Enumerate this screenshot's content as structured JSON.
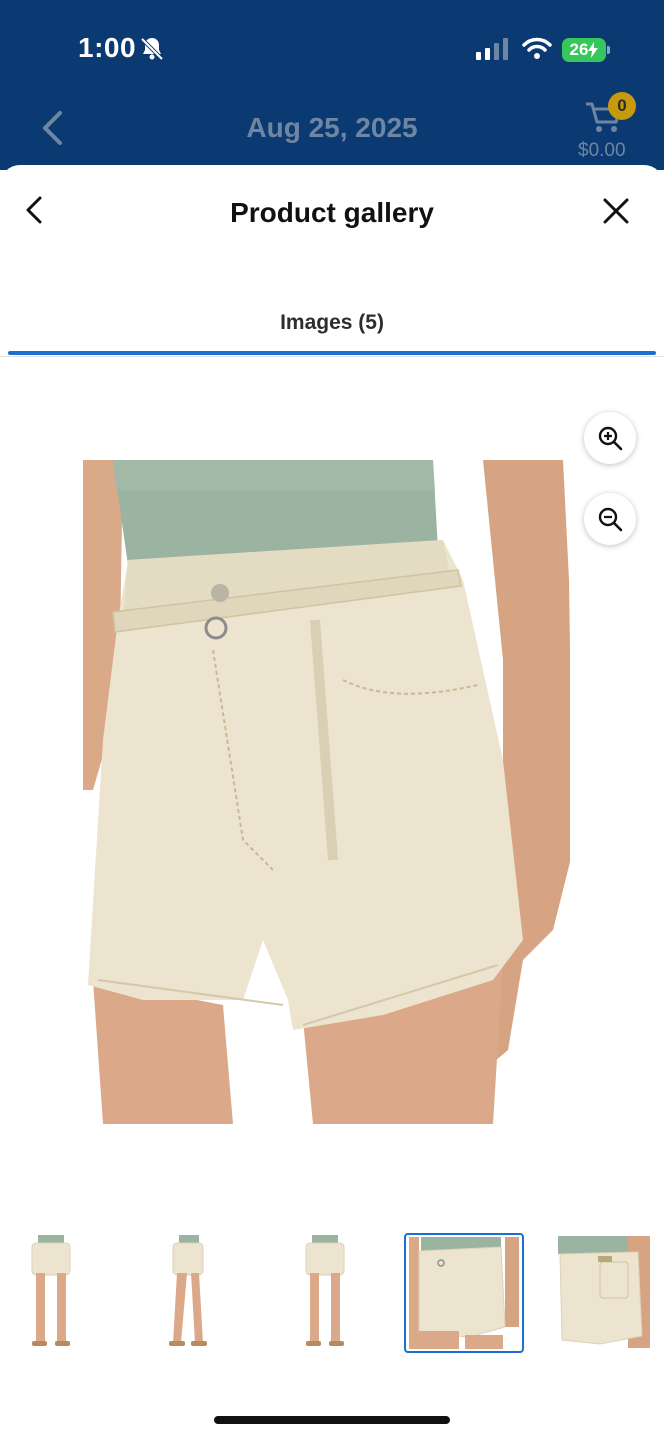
{
  "status_bar": {
    "time": "1:00",
    "battery": "26"
  },
  "header": {
    "date": "Aug 25, 2025",
    "cart_count": "0",
    "cart_total": "$0.00"
  },
  "sheet": {
    "title": "Product gallery"
  },
  "tabs": [
    {
      "label": "Images (5)",
      "selected": true
    }
  ],
  "gallery": {
    "main_image_alt": "Cream high-waisted denim shorts, front close-up",
    "selected_index": 4,
    "thumbnails": [
      {
        "alt": "Full-length front view of model in cream shorts"
      },
      {
        "alt": "Side view of model in cream shorts"
      },
      {
        "alt": "Full-length back view of model in cream shorts"
      },
      {
        "alt": "Front close-up of cream shorts with belt"
      },
      {
        "alt": "Back close-up of cream shorts with pockets"
      }
    ]
  },
  "colors": {
    "header_bg": "#0b3a72",
    "accent": "#1a6fd1",
    "cart_badge": "#c69a0a",
    "battery": "#35c759",
    "fabric": "#ece4cf",
    "top": "#9bb3a1",
    "skin": "#d9a988"
  }
}
